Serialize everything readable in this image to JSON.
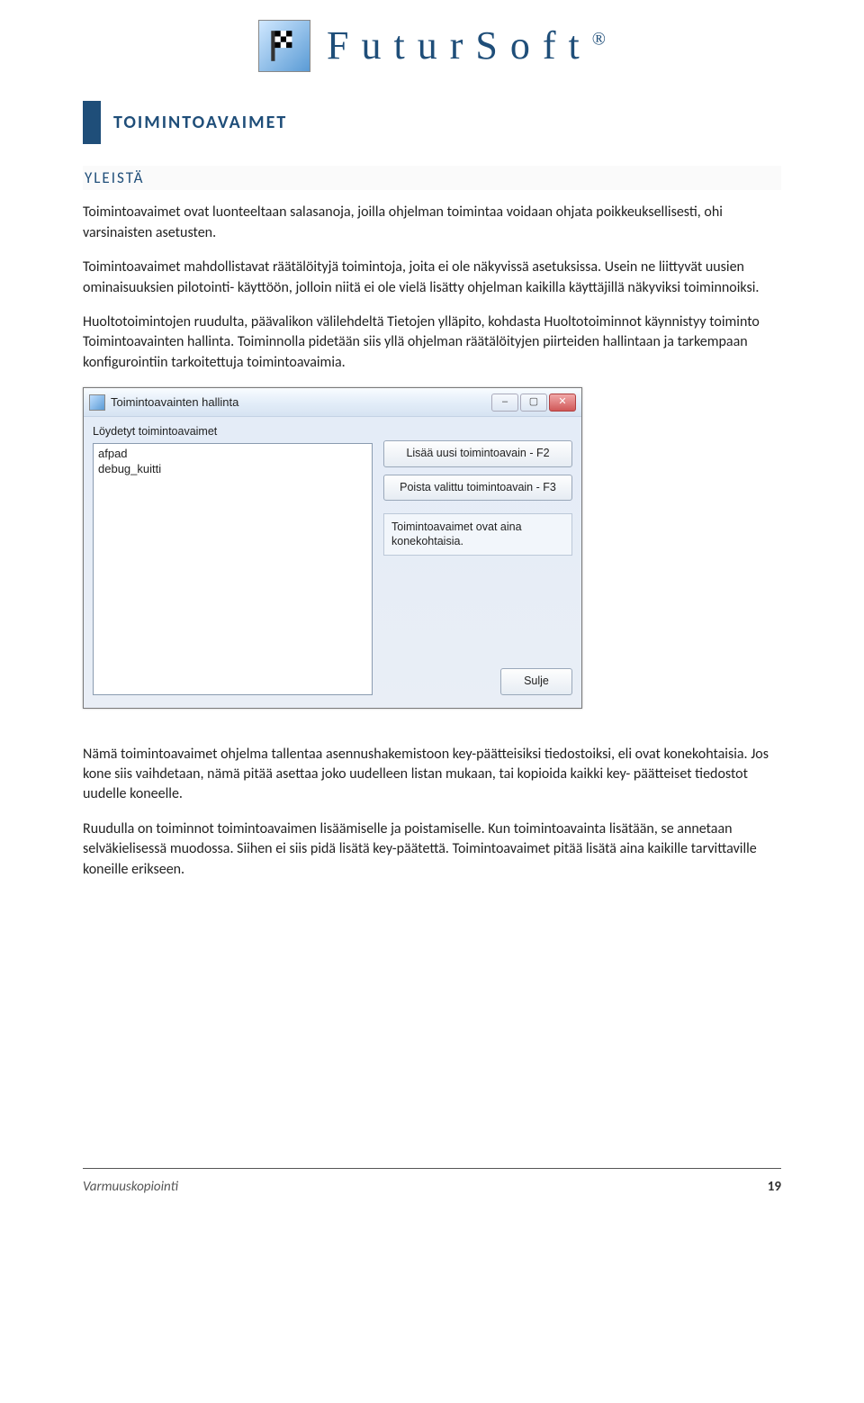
{
  "brand": {
    "name": "FuturSoft",
    "trademark": "®",
    "logo_icon": "checkered-flag-icon"
  },
  "headings": {
    "h1": "TOIMINTOAVAIMET",
    "h2": "YLEISTÄ"
  },
  "paragraphs": {
    "p1": "Toimintoavaimet ovat luonteeltaan salasanoja, joilla ohjelman toimintaa voidaan ohjata poikkeuksellisesti, ohi varsinaisten asetusten.",
    "p2": "Toimintoavaimet mahdollistavat räätälöityjä toimintoja, joita ei ole näkyvissä asetuksissa. Usein ne liittyvät uusien ominaisuuksien pilotointi- käyttöön, jolloin niitä ei ole vielä lisätty ohjelman kaikilla käyttäjillä näkyviksi toiminnoiksi.",
    "p3": "Huoltotoimintojen ruudulta, päävalikon välilehdeltä Tietojen ylläpito, kohdasta Huoltotoiminnot käynnistyy toiminto Toimintoavainten hallinta. Toiminnolla pidetään siis yllä ohjelman räätälöityjen piirteiden hallintaan ja tarkempaan konfigurointiin tarkoitettuja toimintoavaimia.",
    "p4": "Nämä toimintoavaimet ohjelma tallentaa asennushakemistoon key-päätteisiksi tiedostoiksi, eli ovat konekohtaisia. Jos kone siis vaihdetaan, nämä pitää asettaa joko uudelleen listan mukaan, tai kopioida kaikki key- päätteiset tiedostot uudelle koneelle.",
    "p5": "Ruudulla on toiminnot toimintoavaimen lisäämiselle ja poistamiselle. Kun toimintoavainta lisätään, se annetaan selväkielisessä muodossa. Siihen ei siis pidä lisätä key-päätettä. Toimintoavaimet pitää lisätä aina kaikille tarvittaville koneille erikseen."
  },
  "dialog": {
    "title": "Toimintoavainten hallinta",
    "list_label": "Löydetyt toimintoavaimet",
    "list_items": [
      "afpad",
      "debug_kuitti"
    ],
    "add_button": "Lisää uusi toimintoavain - F2",
    "remove_button": "Poista valittu toimintoavain - F3",
    "info_text": "Toimintoavaimet ovat aina konekohtaisia.",
    "close_button": "Sulje",
    "window_controls": {
      "minimize": "–",
      "maximize": "▢",
      "close": "✕"
    }
  },
  "footer": {
    "section": "Varmuuskopiointi",
    "page": "19"
  }
}
